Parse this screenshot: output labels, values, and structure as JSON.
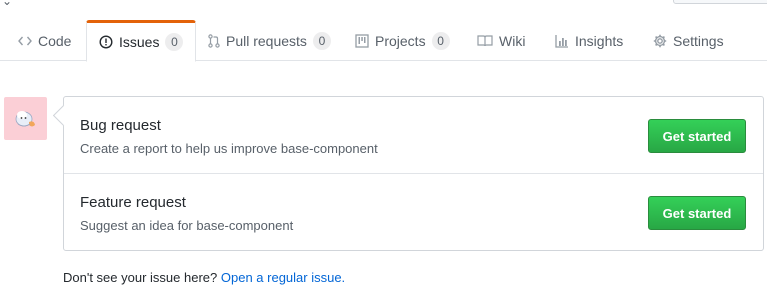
{
  "tabs": [
    {
      "label": "Code",
      "icon": "code-icon"
    },
    {
      "label": "Issues",
      "icon": "issue-opened-icon",
      "count": "0",
      "selected": true
    },
    {
      "label": "Pull requests",
      "icon": "git-pull-request-icon",
      "count": "0"
    },
    {
      "label": "Projects",
      "icon": "project-icon",
      "count": "0"
    },
    {
      "label": "Wiki",
      "icon": "book-icon"
    },
    {
      "label": "Insights",
      "icon": "graph-icon"
    },
    {
      "label": "Settings",
      "icon": "gear-icon"
    }
  ],
  "templates": [
    {
      "title": "Bug request",
      "description": "Create a report to help us improve base-component",
      "button_label": "Get started"
    },
    {
      "title": "Feature request",
      "description": "Suggest an idea for base-component",
      "button_label": "Get started"
    }
  ],
  "footer": {
    "text": "Don't see your issue here?",
    "link_label": "Open a regular issue."
  },
  "colors": {
    "accent_tab": "#e36209",
    "primary_button": "#28a745",
    "link": "#0366d6",
    "avatar_bg": "#fbcfd6"
  }
}
